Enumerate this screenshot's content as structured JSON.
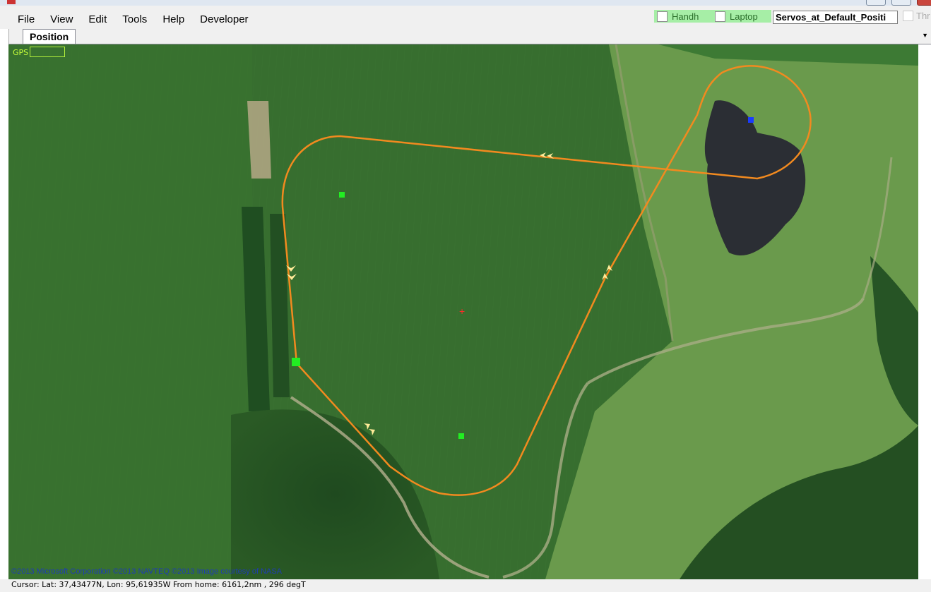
{
  "menu": {
    "items": [
      "File",
      "View",
      "Edit",
      "Tools",
      "Help",
      "Developer"
    ]
  },
  "toolbar": {
    "handh_label": "Handh",
    "laptop_label": "Laptop",
    "servos_value": "Servos_at_Default_Positi",
    "throttle_label": "Thr"
  },
  "tabs": {
    "position_label": "Position"
  },
  "map": {
    "gps_label": "GPS",
    "copyright": "©2013 Microsoft Corporation  ©2013 NAVTEQ  ©2013 Image courtesy of NASA",
    "flight_path_color": "#f28a1f",
    "waypoint_color": "#22ee22",
    "home_marker_color": "#1a3cff",
    "crosshair_color": "#ff2a2a"
  },
  "status": {
    "cursor_text": "Cursor: Lat: 37,43477N, Lon: 95,61935W From home: 6161,2nm , 296 degT"
  }
}
